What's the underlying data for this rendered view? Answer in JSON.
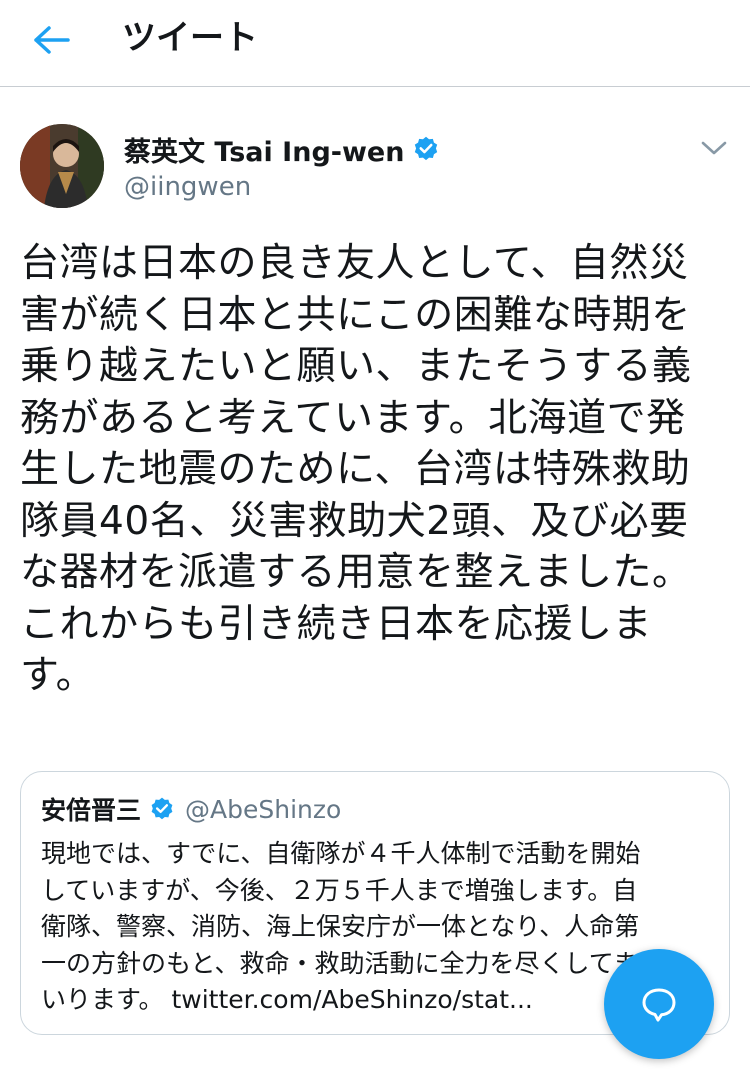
{
  "header": {
    "back_icon": "arrow-left-icon",
    "title": "ツイート"
  },
  "tweet": {
    "author_name": "蔡英文 Tsai Ing-wen",
    "author_handle": "@iingwen",
    "verified": true,
    "verified_icon": "verified-badge-icon",
    "menu_icon": "chevron-down-icon",
    "text": "台湾は日本の良き友人として、自然災\n害が続く日本と共にこの困難な時期を\n乗り越えたいと願い、またそうする義\n務があると考えています。北海道で発\n生した地震のために、台湾は特殊救助\n隊員40名、災害救助犬2頭、及び必要\nな器材を派遣する用意を整えました。\nこれからも引き続き日本を応援しま\nす。"
  },
  "quoted_tweet": {
    "author_name": "安倍晋三",
    "author_handle": "@AbeShinzo",
    "verified": true,
    "text": "現地では、すでに、自衛隊が４千人体制で活動を開始\nしていますが、今後、２万５千人まで増強します。自\n衛隊、警察、消防、海上保安庁が一体となり、人命第\n一の方針のもと、救命・救助活動に全力を尽くしてま\nいります。 twitter.com/AbeShinzo/stat..."
  },
  "fab": {
    "icon": "compose-reply-icon"
  },
  "colors": {
    "accent": "#1da1f2",
    "text": "#14171a",
    "secondary": "#657786",
    "border": "#ccd6dd"
  }
}
